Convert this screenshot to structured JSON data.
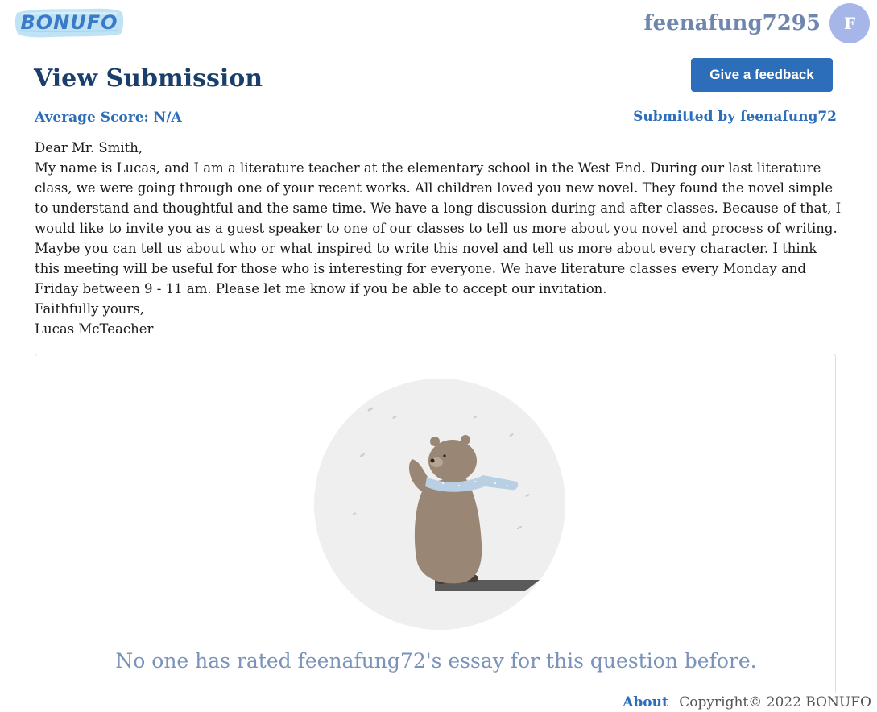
{
  "header": {
    "logo_text": "BONUFO",
    "username": "feenafung7295",
    "avatar_initial": "F"
  },
  "main": {
    "title": "View Submission",
    "feedback_button_label": "Give a feedback",
    "average_score": "Average Score: N/A",
    "submitted_by": "Submitted by feenafung72",
    "essay_lines": [
      "Dear Mr. Smith,",
      "My name is Lucas, and I am a literature teacher at the elementary school in the West End. During our last literature class, we were going through one of your recent works. All children loved you new novel. They found the novel simple to understand and thoughtful and the same time. We have a long discussion during and after classes. Because of that, I would like to invite you as a guest speaker to one of our classes to tell us more about you novel and process of writing. Maybe you can tell us about who or what inspired to write this novel and tell us more about every character. I think this meeting will be useful for those who is interesting for everyone. We have literature classes every Monday and Friday between 9 - 11 am. Please let me know if you be able to accept our invitation.",
      "Faithfully yours,",
      "Lucas McTeacher"
    ],
    "empty_feedback_message": "No one has rated feenafung72's essay for this question before."
  },
  "footer": {
    "about_label": "About",
    "copyright": "Copyright© 2022 BONUFO"
  },
  "colors": {
    "brand_blue": "#2c6eb9",
    "title_navy": "#1b3f6b",
    "username_gray_blue": "#6f86ae",
    "avatar_bg": "#a7b6e8",
    "empty_message": "#7a93b8"
  },
  "icons": {
    "illustration": "bear-with-scarf-illustration"
  }
}
